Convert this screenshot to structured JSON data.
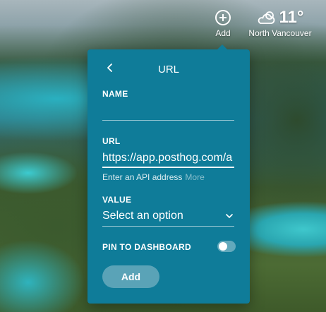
{
  "topbar": {
    "add": {
      "label": "Add",
      "icon": "plus-circle-icon"
    },
    "weather": {
      "temperature": "11°",
      "city": "North Vancouver",
      "icon": "cloud-sun-icon"
    }
  },
  "popover": {
    "title": "URL",
    "back_icon": "chevron-left-icon",
    "name": {
      "label": "NAME",
      "value": ""
    },
    "url": {
      "label": "URL",
      "value": "https://app.posthog.com/a",
      "hint": "Enter an API address",
      "more": "More"
    },
    "value": {
      "label": "VALUE",
      "selected": "Select an option",
      "icon": "chevron-down-icon"
    },
    "pin": {
      "label": "PIN TO DASHBOARD",
      "enabled": false
    },
    "submit_label": "Add",
    "colors": {
      "panel": "#0f7c99",
      "button": "#5aa3b7"
    }
  }
}
